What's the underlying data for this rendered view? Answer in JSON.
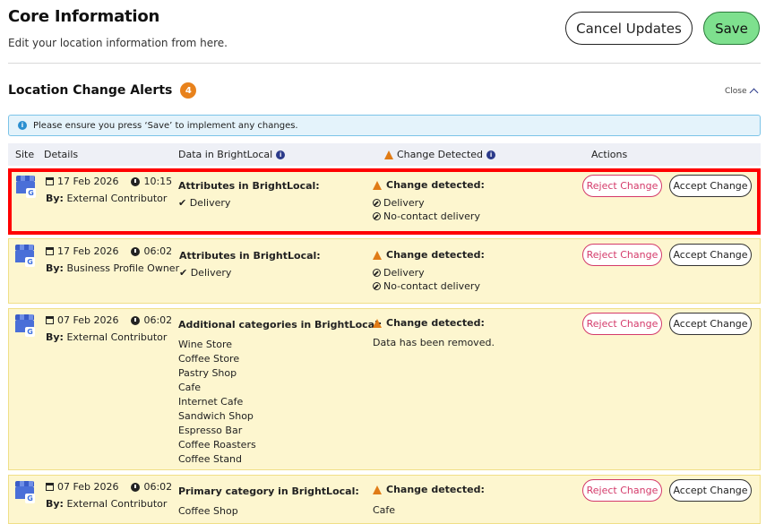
{
  "header": {
    "title": "Core Information",
    "subtitle": "Edit your location information from here.",
    "cancel_label": "Cancel Updates",
    "save_label": "Save"
  },
  "alerts": {
    "title": "Location Change Alerts",
    "count": "4",
    "close_label": "Close",
    "info_text": "Please ensure you press ‘Save’ to implement any changes.",
    "columns": {
      "site": "Site",
      "details": "Details",
      "data": "Data in BrightLocal",
      "change": "Change Detected",
      "actions": "Actions"
    },
    "reject_label": "Reject Change",
    "accept_label": "Accept Change",
    "rows": [
      {
        "date": "17 Feb 2026",
        "time": "10:15",
        "by_label": "By:",
        "by": "External Contributor",
        "data_head": "Attributes in BrightLocal:",
        "data_items": [
          "✔ Delivery"
        ],
        "change_head": "Change detected:",
        "change_items": [
          "Delivery",
          "No-contact delivery"
        ]
      },
      {
        "date": "17 Feb 2026",
        "time": "06:02",
        "by_label": "By:",
        "by": "Business Profile Owner",
        "data_head": "Attributes in BrightLocal:",
        "data_items": [
          "✔ Delivery"
        ],
        "change_head": "Change detected:",
        "change_items": [
          "Delivery",
          "No-contact delivery"
        ]
      },
      {
        "date": "07 Feb 2026",
        "time": "06:02",
        "by_label": "By:",
        "by": "External Contributor",
        "data_head": "Additional categories in BrightLocal:",
        "data_items": [
          "Wine Store",
          "Coffee Store",
          "Pastry Shop",
          "Cafe",
          "Internet Cafe",
          "Sandwich Shop",
          "Espresso Bar",
          "Coffee Roasters",
          "Coffee Stand"
        ],
        "change_head": "Change detected:",
        "change_text": "Data has been removed."
      },
      {
        "date": "07 Feb 2026",
        "time": "06:02",
        "by_label": "By:",
        "by": "External Contributor",
        "data_head": "Primary category in BrightLocal:",
        "data_items": [
          "Coffee Shop"
        ],
        "change_head": "Change detected:",
        "change_text": "Cafe"
      }
    ]
  },
  "colors": {
    "save_bg": "#7ee08e",
    "badge": "#e8821c",
    "reject": "#d43a6a",
    "row_bg": "#fdf6cf",
    "highlight": "#ff0000"
  }
}
